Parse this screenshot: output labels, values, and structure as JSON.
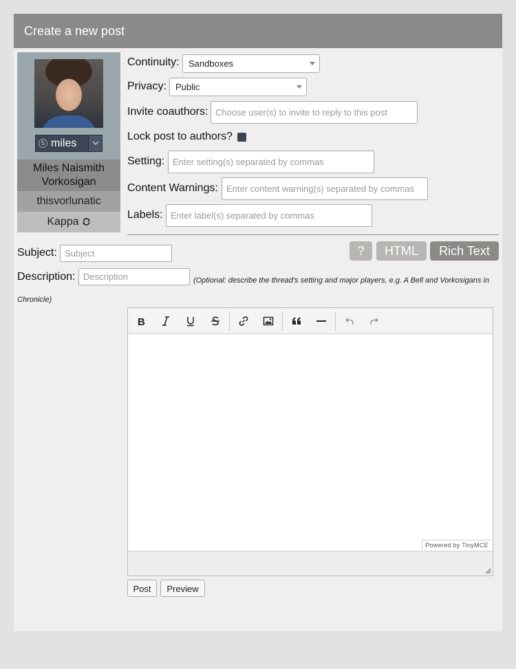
{
  "header": {
    "title": "Create a new post"
  },
  "character": {
    "alias_label": "miles",
    "name": "Miles Naismith Vorkosigan",
    "screen_name": "thisvorlunatic",
    "template": "Kappa"
  },
  "form": {
    "continuity": {
      "label": "Continuity:",
      "value": "Sandboxes"
    },
    "privacy": {
      "label": "Privacy:",
      "value": "Public"
    },
    "coauthors": {
      "label": "Invite coauthors:",
      "placeholder": "Choose user(s) to invite to reply to this post"
    },
    "lock": {
      "label": "Lock post to authors?"
    },
    "setting": {
      "label": "Setting:",
      "placeholder": "Enter setting(s) separated by commas"
    },
    "warnings": {
      "label": "Content Warnings:",
      "placeholder": "Enter content warning(s) separated by commas"
    },
    "labels": {
      "label": "Labels:",
      "placeholder": "Enter label(s) separated by commas"
    },
    "subject": {
      "label": "Subject:",
      "placeholder": "Subject"
    },
    "description": {
      "label": "Description:",
      "placeholder": "Description",
      "note": "(Optional: describe the thread's setting and major players, e.g. A Bell and Vorkosigans in Chronicle)"
    }
  },
  "editor_modes": {
    "help": "?",
    "html": "HTML",
    "rich_text": "Rich Text",
    "active": "rich_text"
  },
  "editor": {
    "toolbar_icons": [
      "bold-icon",
      "italic-icon",
      "underline-icon",
      "strikethrough-icon",
      "link-icon",
      "image-icon",
      "blockquote-icon",
      "horizontal-rule-icon",
      "undo-icon",
      "redo-icon"
    ],
    "powered_by": "Powered by TinyMCE"
  },
  "actions": {
    "post": "Post",
    "preview": "Preview"
  }
}
